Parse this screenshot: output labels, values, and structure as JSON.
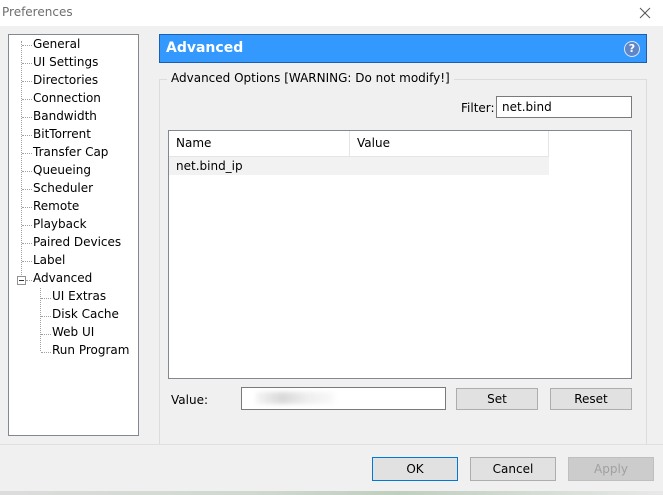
{
  "window": {
    "title": "Preferences"
  },
  "sidebar": {
    "items": [
      {
        "label": "General"
      },
      {
        "label": "UI Settings"
      },
      {
        "label": "Directories"
      },
      {
        "label": "Connection"
      },
      {
        "label": "Bandwidth"
      },
      {
        "label": "BitTorrent"
      },
      {
        "label": "Transfer Cap"
      },
      {
        "label": "Queueing"
      },
      {
        "label": "Scheduler"
      },
      {
        "label": "Remote"
      },
      {
        "label": "Playback"
      },
      {
        "label": "Paired Devices"
      },
      {
        "label": "Label"
      },
      {
        "label": "Advanced"
      }
    ],
    "advanced_children": [
      {
        "label": "UI Extras"
      },
      {
        "label": "Disk Cache"
      },
      {
        "label": "Web UI"
      },
      {
        "label": "Run Program"
      }
    ]
  },
  "header": {
    "title": "Advanced",
    "help_glyph": "?",
    "accent": "#3399ff"
  },
  "options": {
    "group_title": "Advanced Options [WARNING: Do not modify!]",
    "filter_label": "Filter:",
    "filter_value": "net.bind",
    "columns": [
      "Name",
      "Value"
    ],
    "rows": [
      {
        "name": "net.bind_ip",
        "value": ""
      }
    ],
    "value_label": "Value:",
    "set_label": "Set",
    "reset_label": "Reset"
  },
  "footer": {
    "ok_label": "OK",
    "cancel_label": "Cancel",
    "apply_label": "Apply"
  }
}
